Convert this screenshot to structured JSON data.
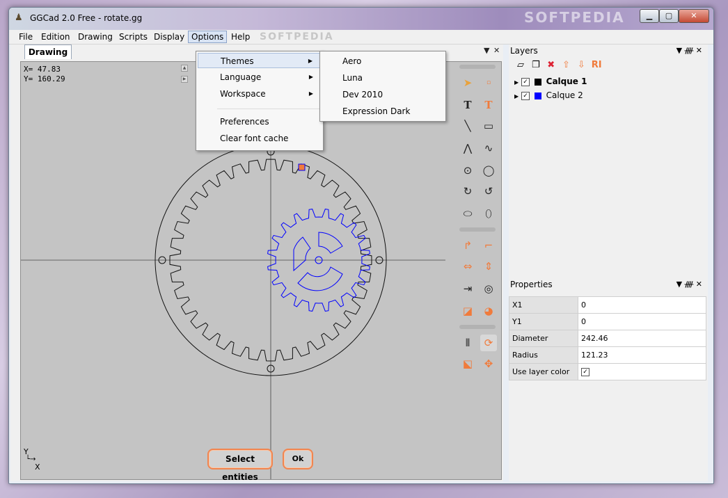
{
  "window": {
    "title": "GGCad 2.0 Free - rotate.gg",
    "minimize": "▁",
    "maximize": "▢",
    "close": "✕"
  },
  "menu": {
    "items": [
      "File",
      "Edition",
      "Drawing",
      "Scripts",
      "Display",
      "Options",
      "Help"
    ],
    "active": "Options"
  },
  "drawing": {
    "tab_label": "Drawing",
    "x_coord": "X= 47.83",
    "y_coord": "Y= 160.29",
    "axis_y": "Y",
    "axis_x": "X",
    "select_entities": "Select entities",
    "ok": "Ok"
  },
  "options_menu": {
    "themes": "Themes",
    "language": "Language",
    "workspace": "Workspace",
    "preferences": "Preferences",
    "clear_font_cache": "Clear font cache"
  },
  "themes_submenu": [
    "Aero",
    "Luna",
    "Dev 2010",
    "Expression Dark"
  ],
  "layers": {
    "title": "Layers",
    "items": [
      {
        "name": "Calque 1",
        "color": "#000000",
        "checked": true,
        "bold": true
      },
      {
        "name": "Calque 2",
        "color": "#0000ff",
        "checked": true,
        "bold": false
      }
    ]
  },
  "properties": {
    "title": "Properties",
    "rows": [
      {
        "key": "X1",
        "value": "0"
      },
      {
        "key": "Y1",
        "value": "0"
      },
      {
        "key": "Diameter",
        "value": "242.46"
      },
      {
        "key": "Radius",
        "value": "121.23"
      },
      {
        "key": "Use layer color",
        "value": "✓"
      }
    ]
  },
  "colors": {
    "accent_orange": "#f08550",
    "selection_blue": "#0000ff",
    "canvas": "#c4c4c4"
  }
}
